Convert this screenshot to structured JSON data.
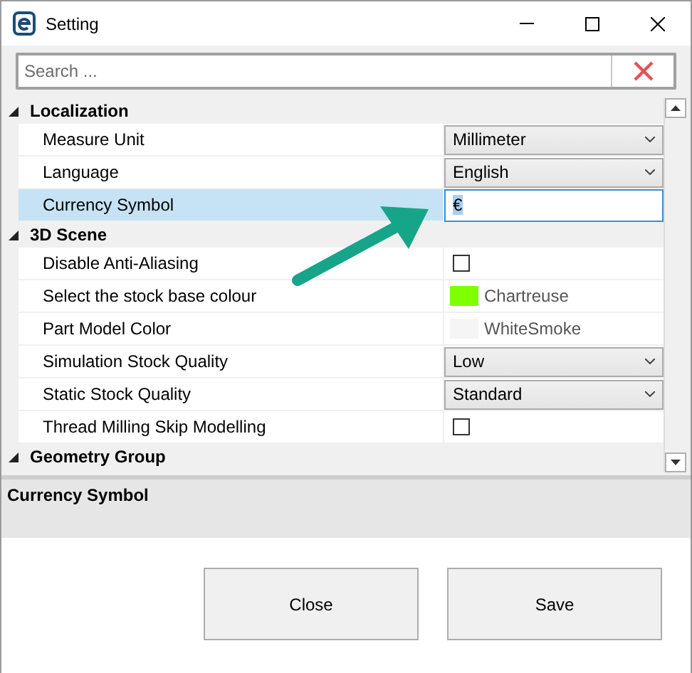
{
  "window": {
    "title": "Setting"
  },
  "search": {
    "placeholder": "Search ..."
  },
  "categories": [
    {
      "name": "Localization",
      "expanded": true,
      "rows": [
        {
          "label": "Measure Unit",
          "kind": "dropdown",
          "value": "Millimeter",
          "selected": false
        },
        {
          "label": "Language",
          "kind": "dropdown",
          "value": "English",
          "selected": false
        },
        {
          "label": "Currency Symbol",
          "kind": "text",
          "value": "€",
          "selected": true
        }
      ]
    },
    {
      "name": "3D Scene",
      "expanded": true,
      "rows": [
        {
          "label": "Disable Anti-Aliasing",
          "kind": "checkbox",
          "checked": false,
          "selected": false
        },
        {
          "label": "Select the stock base colour",
          "kind": "color",
          "color": "#7fff00",
          "value": "Chartreuse",
          "selected": false
        },
        {
          "label": "Part Model Color",
          "kind": "color",
          "color": "#f5f5f5",
          "value": "WhiteSmoke",
          "selected": false
        },
        {
          "label": "Simulation Stock Quality",
          "kind": "dropdown",
          "value": "Low",
          "selected": false
        },
        {
          "label": "Static Stock Quality",
          "kind": "dropdown",
          "value": "Standard",
          "selected": false
        },
        {
          "label": "Thread Milling Skip Modelling",
          "kind": "checkbox",
          "checked": false,
          "selected": false
        }
      ]
    },
    {
      "name": "Geometry Group",
      "expanded": true
    }
  ],
  "description": {
    "title": "Currency Symbol"
  },
  "buttons": [
    {
      "label": "Close"
    },
    {
      "label": "Save"
    }
  ]
}
